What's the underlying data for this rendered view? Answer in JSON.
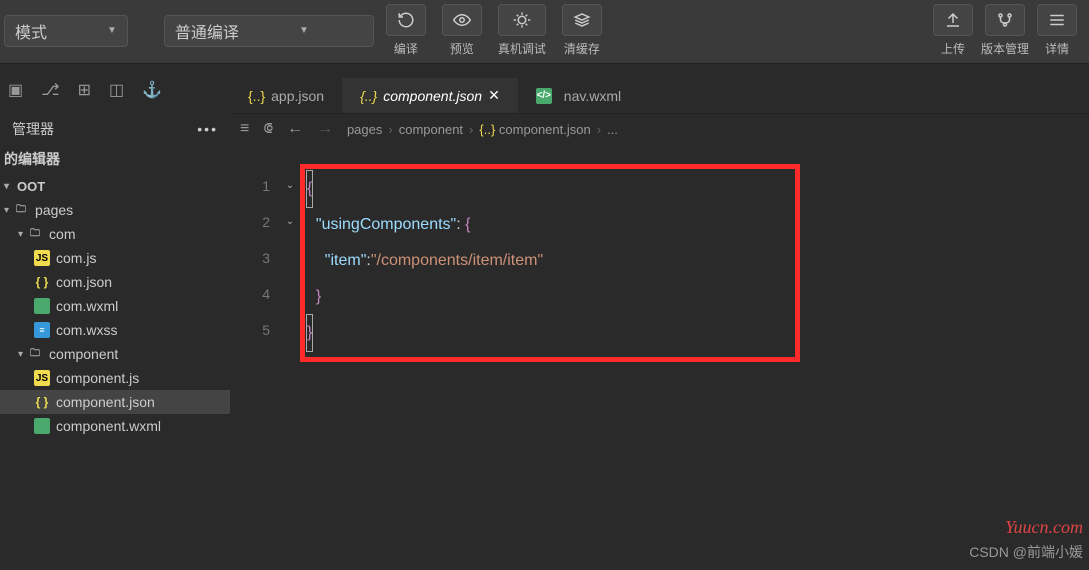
{
  "toolbar": {
    "mode_label": "模式",
    "compile_mode_label": "普通编译",
    "actions": {
      "compile": "编译",
      "preview": "预览",
      "remote_debug": "真机调试",
      "clear_cache": "清缓存",
      "upload": "上传",
      "version": "版本管理",
      "detail": "详情"
    }
  },
  "sidebar": {
    "header": "管理器",
    "editor_title": "的编辑器",
    "root": "OOT",
    "items": [
      {
        "label": "pages",
        "type": "folder",
        "indent": 0
      },
      {
        "label": "com",
        "type": "folder",
        "indent": 1
      },
      {
        "label": "com.js",
        "type": "js",
        "indent": 2
      },
      {
        "label": "com.json",
        "type": "json",
        "indent": 2
      },
      {
        "label": "com.wxml",
        "type": "wxml",
        "indent": 2
      },
      {
        "label": "com.wxss",
        "type": "wxss",
        "indent": 2
      },
      {
        "label": "component",
        "type": "folder",
        "indent": 1
      },
      {
        "label": "component.js",
        "type": "js",
        "indent": 2
      },
      {
        "label": "component.json",
        "type": "json",
        "indent": 2,
        "active": true
      },
      {
        "label": "component.wxml",
        "type": "wxml",
        "indent": 2
      }
    ]
  },
  "tabs": [
    {
      "label": "app.json",
      "type": "json",
      "active": false
    },
    {
      "label": "component.json",
      "type": "json",
      "active": true
    },
    {
      "label": "nav.wxml",
      "type": "wxml",
      "active": false
    }
  ],
  "breadcrumb": [
    "pages",
    "component",
    "component.json",
    "..."
  ],
  "code": {
    "lines": [
      "1",
      "2",
      "3",
      "4",
      "5"
    ],
    "content": {
      "l2_key": "\"usingComponents\"",
      "l3_key": "\"item\"",
      "l3_val": "\"/components/item/item\""
    }
  },
  "watermark1": "Yuucn.com",
  "watermark2": "CSDN @前端小媛"
}
